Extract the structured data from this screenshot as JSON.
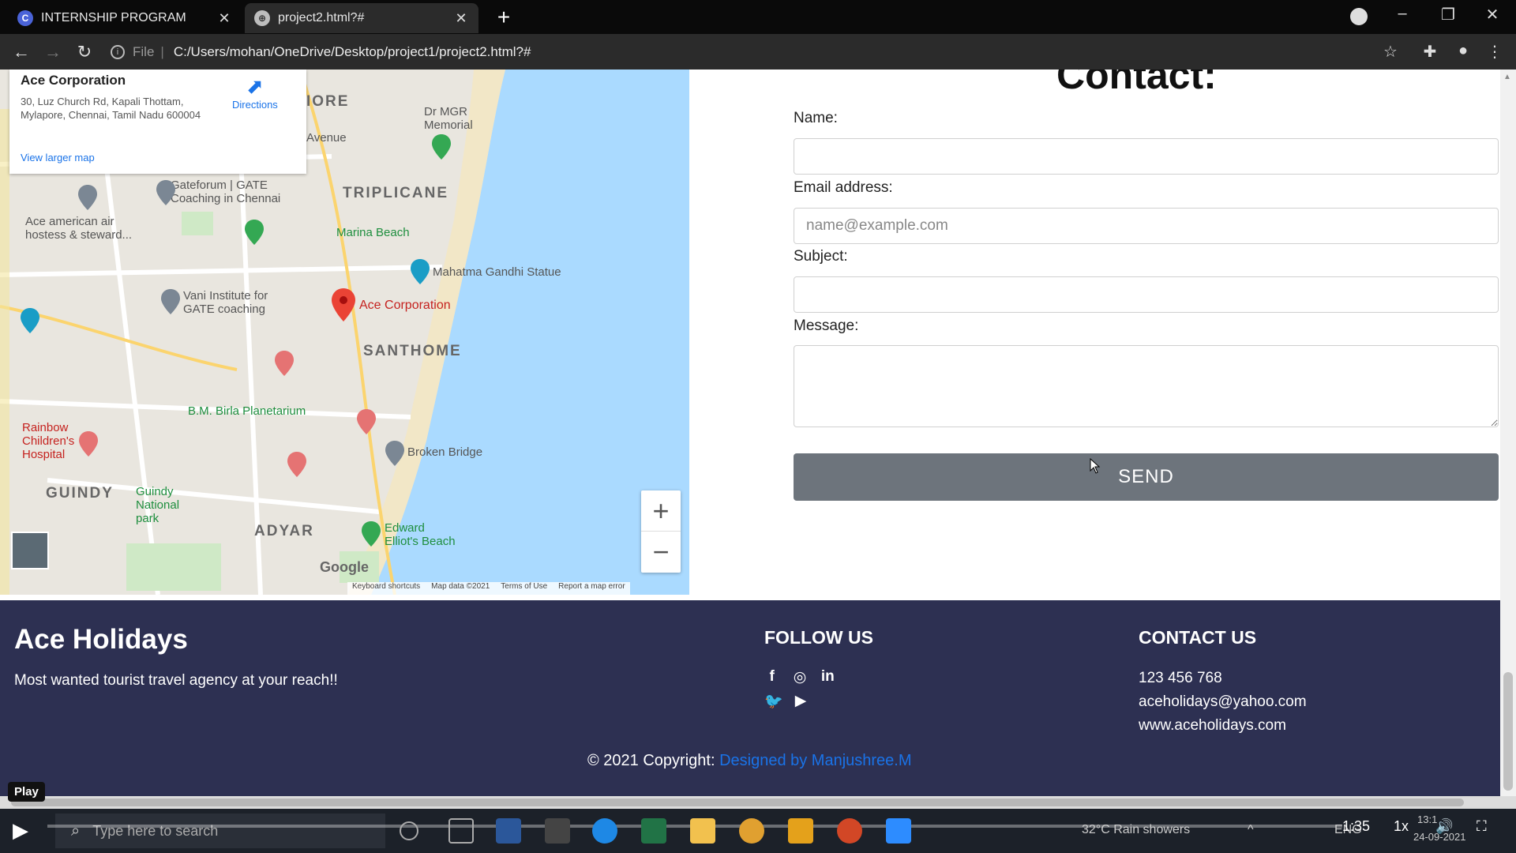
{
  "browser": {
    "tabs": [
      {
        "label": "INTERNSHIP PROGRAM",
        "favicon": "C"
      },
      {
        "label": "project2.html?#",
        "favicon": "⊕"
      }
    ],
    "address": {
      "scheme_label": "File",
      "url": "C:/Users/mohan/OneDrive/Desktop/project1/project2.html?#"
    }
  },
  "map": {
    "card": {
      "place": "Ace Corporation",
      "address": "30, Luz Church Rd, Kapali Thottam, Mylapore, Chennai, Tamil Nadu 600004",
      "directions": "Directions",
      "larger_map": "View larger map"
    },
    "labels": {
      "more": "IORE",
      "mgr": "Dr MGR Memorial",
      "avenue": "Avenue",
      "gateforum": "Gateforum | GATE Coaching in Chennai",
      "triplicane": "TRIPLICANE",
      "ace_air": "Ace american air hostess & steward...",
      "marina": "Marina Beach",
      "gandhi": "Mahatma Gandhi Statue",
      "vani": "Vani Institute for GATE coaching",
      "ace_corp": "Ace Corporation",
      "santhome": "SANTHOME",
      "planetarium": "B.M. Birla Planetarium",
      "rainbow": "Rainbow Children's Hospital",
      "broken": "Broken Bridge",
      "guindy": "GUINDY",
      "guindy_park": "Guindy National park",
      "adyar": "ADYAR",
      "elliot": "Edward Elliot's Beach",
      "google": "Google"
    },
    "footer": [
      "Keyboard shortcuts",
      "Map data ©2021",
      "Terms of Use",
      "Report a map error"
    ],
    "zoom_in": "+",
    "zoom_out": "−"
  },
  "contact": {
    "title": "Contact:",
    "name_label": "Name:",
    "email_label": "Email address:",
    "email_placeholder": "name@example.com",
    "subject_label": "Subject:",
    "message_label": "Message:",
    "send_label": "SEND"
  },
  "footer": {
    "brand": "Ace Holidays",
    "tagline": "Most wanted tourist travel agency at your reach!!",
    "follow_heading": "FOLLOW US",
    "social_icons": [
      "facebook-icon",
      "instagram-icon",
      "linkedin-icon",
      "twitter-icon",
      "youtube-icon"
    ],
    "contact_heading": "CONTACT US",
    "phone": "123 456 768",
    "email": "aceholidays@yahoo.com",
    "website": "www.aceholidays.com",
    "copyright_prefix": "© 2021 Copyright:",
    "copyright_link": "Designed by Manjushree.M"
  },
  "player": {
    "play_tooltip": "Play",
    "elapsed": "1:35",
    "speed": "1x"
  },
  "taskbar": {
    "search_placeholder": "Type here to search",
    "weather": "32°C  Rain showers",
    "lang": "ENG",
    "clock_time": "13:1",
    "clock_date": "24-09-2021"
  },
  "colors": {
    "footer_bg": "#2d3052",
    "send_button": "#6d747c",
    "link": "#1a73e8",
    "water": "#aadaff"
  }
}
